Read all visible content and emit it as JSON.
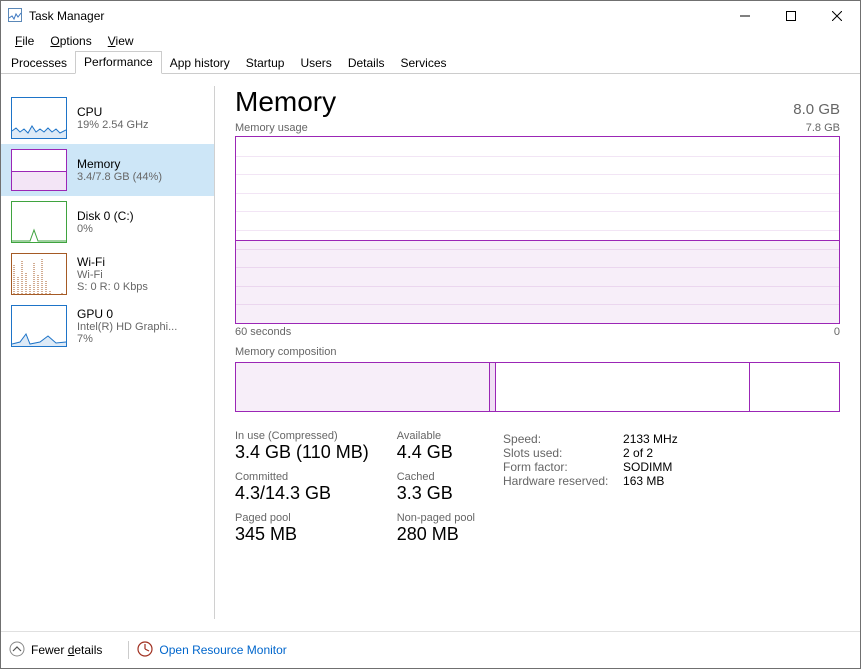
{
  "window": {
    "title": "Task Manager"
  },
  "menu": {
    "file": "File",
    "options": "Options",
    "view": "View"
  },
  "tabs": {
    "processes": "Processes",
    "performance": "Performance",
    "apphistory": "App history",
    "startup": "Startup",
    "users": "Users",
    "details": "Details",
    "services": "Services"
  },
  "nav": {
    "cpu": {
      "title": "CPU",
      "sub": "19% 2.54 GHz"
    },
    "memory": {
      "title": "Memory",
      "sub": "3.4/7.8 GB (44%)"
    },
    "disk": {
      "title": "Disk 0 (C:)",
      "sub": "0%"
    },
    "wifi": {
      "title": "Wi-Fi",
      "sub1": "Wi-Fi",
      "sub2": "S: 0 R: 0 Kbps"
    },
    "gpu": {
      "title": "GPU 0",
      "sub1": "Intel(R) HD Graphi...",
      "sub2": "7%"
    }
  },
  "header": {
    "title": "Memory",
    "capacity": "8.0 GB"
  },
  "usage_graph": {
    "label": "Memory usage",
    "max": "7.8 GB",
    "x_left": "60 seconds",
    "x_right": "0"
  },
  "composition": {
    "label": "Memory composition"
  },
  "chart_data": {
    "type": "area",
    "title": "Memory usage",
    "ylabel": "GB",
    "xlabel": "seconds",
    "ylim": [
      0,
      7.8
    ],
    "xlim": [
      60,
      0
    ],
    "values_gb_approx": 3.4,
    "fill_fraction": 0.44,
    "composition_segments": [
      {
        "name": "in_use",
        "fraction": 0.42
      },
      {
        "name": "modified",
        "fraction": 0.01
      },
      {
        "name": "standby",
        "fraction": 0.42
      },
      {
        "name": "free",
        "fraction": 0.15
      }
    ]
  },
  "stats": {
    "inuse_l": "In use (Compressed)",
    "inuse_v": "3.4 GB (110 MB)",
    "available_l": "Available",
    "available_v": "4.4 GB",
    "committed_l": "Committed",
    "committed_v": "4.3/14.3 GB",
    "cached_l": "Cached",
    "cached_v": "3.3 GB",
    "paged_l": "Paged pool",
    "paged_v": "345 MB",
    "nonpaged_l": "Non-paged pool",
    "nonpaged_v": "280 MB"
  },
  "info": {
    "speed_l": "Speed:",
    "speed_v": "2133 MHz",
    "slots_l": "Slots used:",
    "slots_v": "2 of 2",
    "form_l": "Form factor:",
    "form_v": "SODIMM",
    "hw_l": "Hardware reserved:",
    "hw_v": "163 MB"
  },
  "footer": {
    "fewer_pre": "Fewer ",
    "fewer_u": "d",
    "fewer_post": "etails",
    "open": "Open Resource Monitor"
  }
}
